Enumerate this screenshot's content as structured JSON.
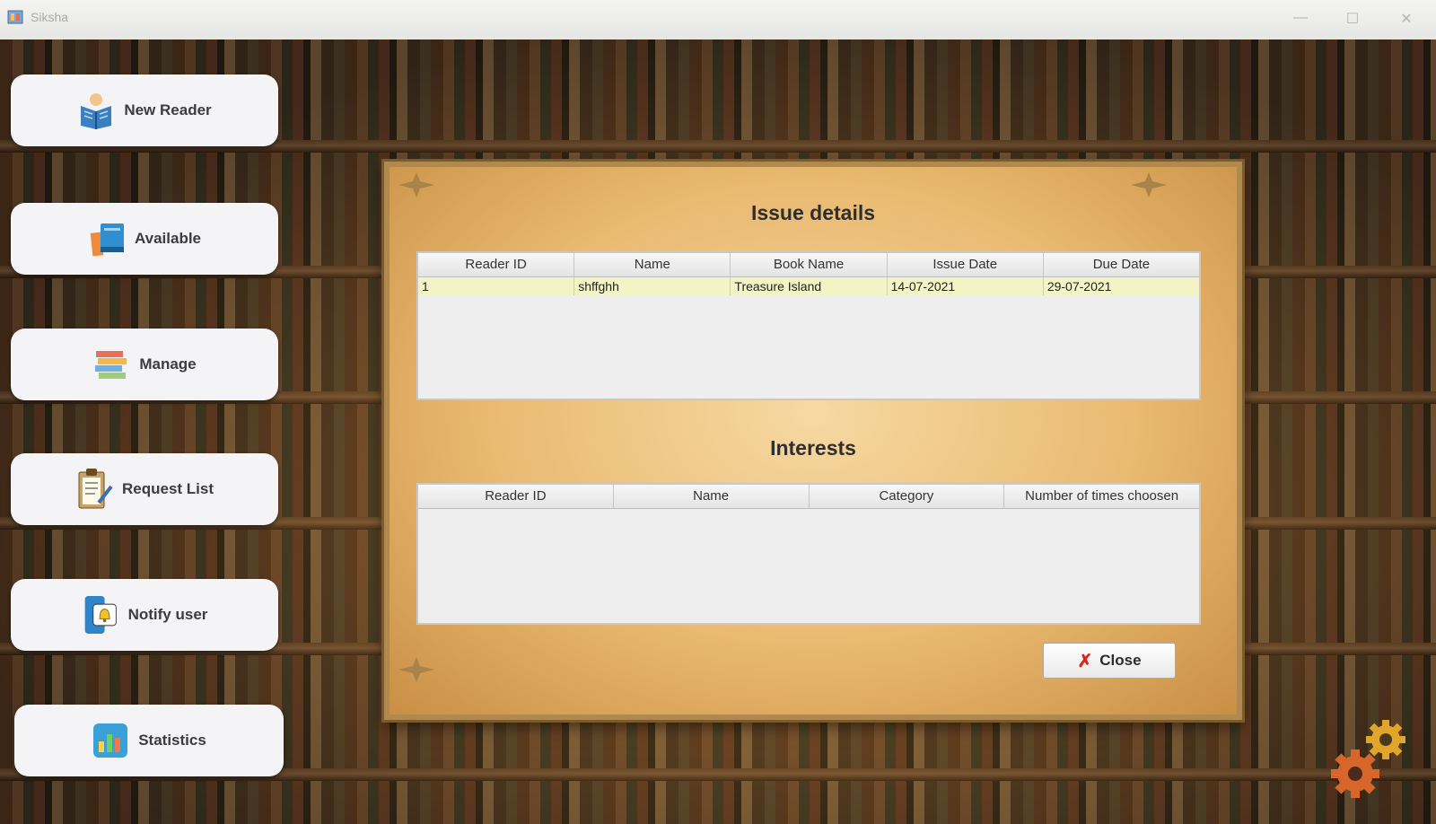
{
  "window": {
    "title": "Siksha",
    "controls": [
      "—",
      "☐",
      "✕"
    ]
  },
  "sidebar": {
    "items": [
      {
        "label": "New Reader",
        "icon": "reader-book-icon"
      },
      {
        "label": "Available",
        "icon": "books-icon"
      },
      {
        "label": "Manage",
        "icon": "manage-books-icon"
      },
      {
        "label": "Request List",
        "icon": "clipboard-icon"
      },
      {
        "label": "Notify user",
        "icon": "bell-phone-icon"
      },
      {
        "label": "Statistics",
        "icon": "chart-icon"
      }
    ]
  },
  "dialog": {
    "issue_title": "Issue details",
    "issue_table": {
      "headers": [
        "Reader ID",
        "Name",
        "Book Name",
        "Issue Date",
        "Due Date"
      ],
      "rows": [
        [
          "1",
          "shffghh",
          "Treasure Island",
          "14-07-2021",
          "29-07-2021"
        ]
      ]
    },
    "interests_title": "Interests",
    "interests_table": {
      "headers": [
        "Reader ID",
        "Name",
        "Category",
        "Number of times choosen"
      ],
      "rows": []
    },
    "close_label": "Close",
    "close_icon": "close-x-icon"
  },
  "settings_icon": "gears-icon",
  "colors": {
    "selected_row": "#f3f4c6",
    "close_x": "#d8281e",
    "parchment": "#e9b970"
  }
}
